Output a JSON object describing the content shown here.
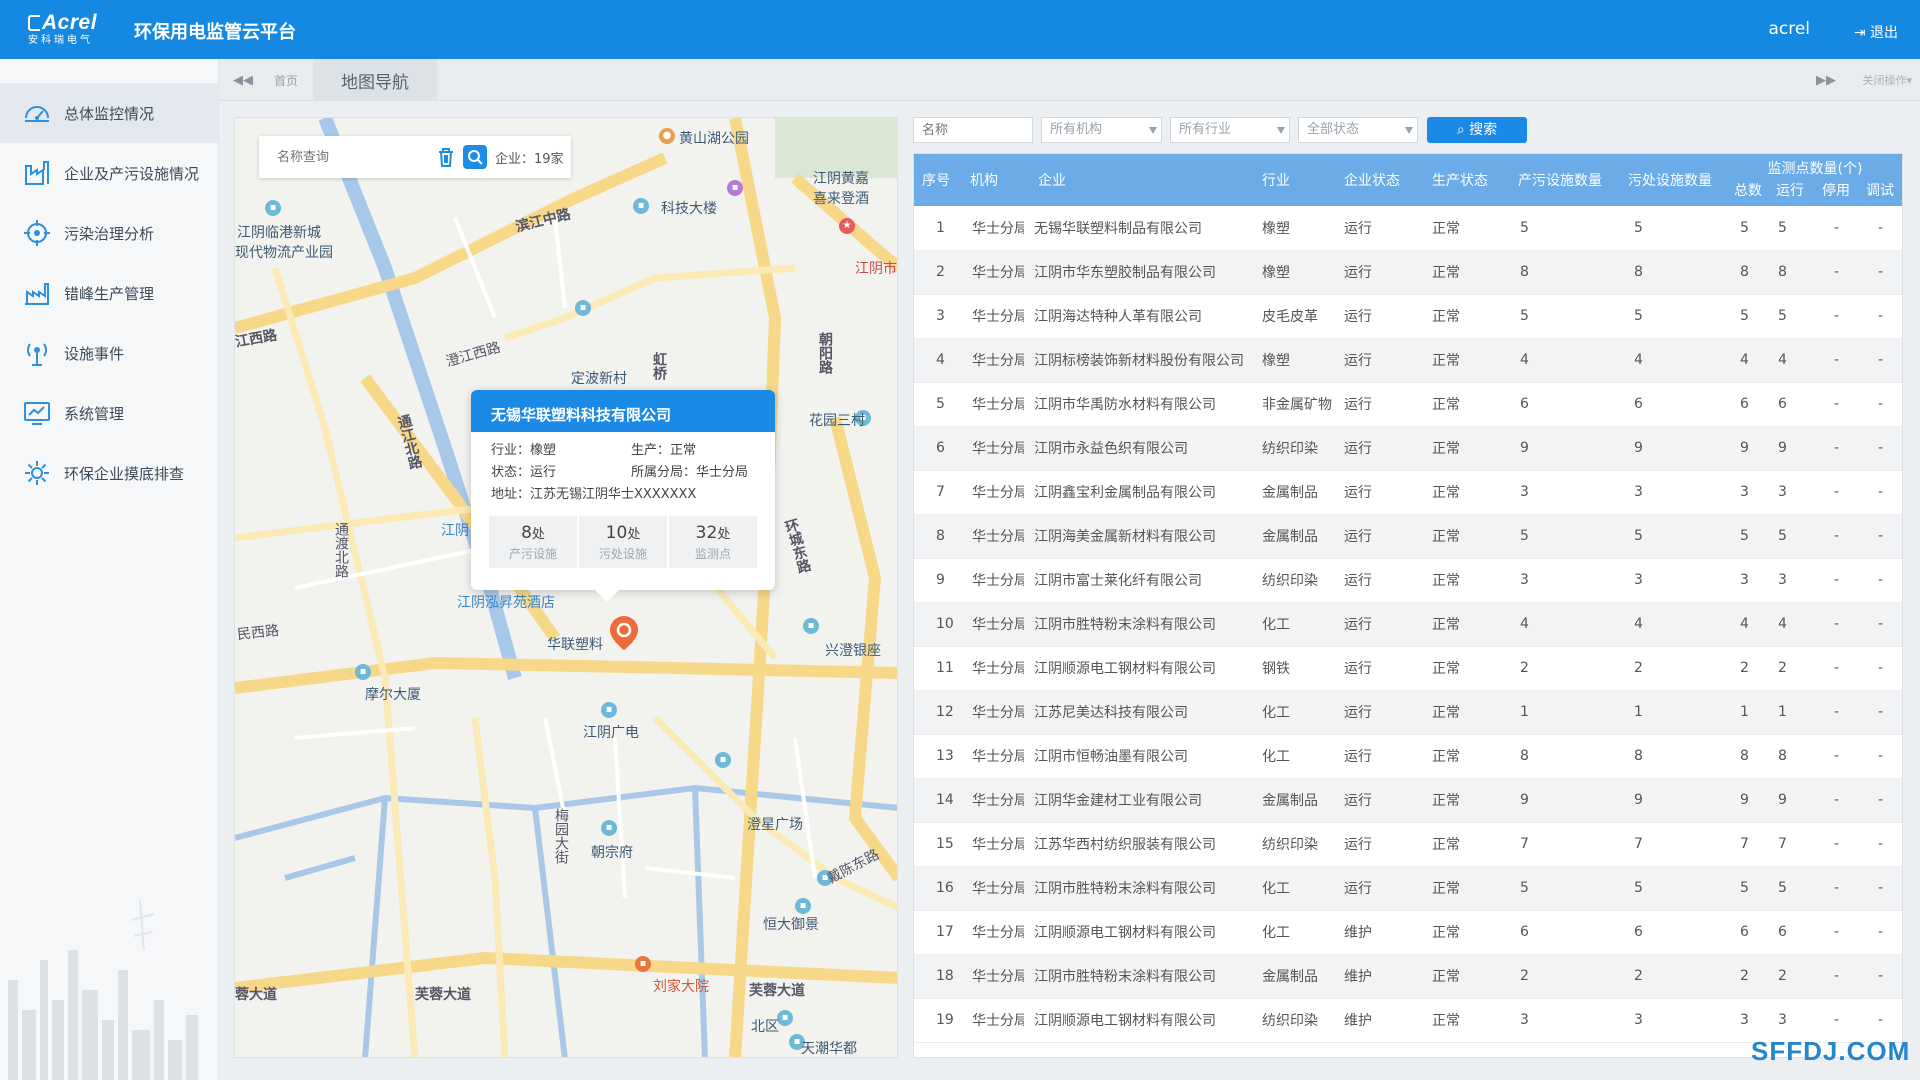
{
  "header": {
    "brand": "Acrel",
    "brand_sub": "安科瑞电气",
    "platform_title": "环保用电监管云平台",
    "username": "acrel",
    "logout_label": "退出",
    "color": "#1588e2"
  },
  "sidebar": {
    "items": [
      {
        "label": "总体监控情况",
        "icon": "dashboard-icon",
        "active": true
      },
      {
        "label": "企业及产污设施情况",
        "icon": "factory-icon"
      },
      {
        "label": "污染治理分析",
        "icon": "target-icon"
      },
      {
        "label": "错峰生产管理",
        "icon": "factory-line-icon"
      },
      {
        "label": "设施事件",
        "icon": "broadcast-icon"
      },
      {
        "label": "系统管理",
        "icon": "monitor-chart-icon"
      },
      {
        "label": "环保企业摸底排查",
        "icon": "gear-icon"
      }
    ]
  },
  "tabs": {
    "home": "首页",
    "map_nav": "地图导航",
    "close_ops": "关闭操作"
  },
  "map": {
    "search_placeholder": "名称查询",
    "company_count": "企业：19家",
    "labels": [
      "黄山湖公园",
      "科技大楼",
      "滨江中路",
      "江阴临港新城",
      "现代物流产业园",
      "江阴黄嘉",
      "喜来登酒",
      "江阴市",
      "江西路",
      "澄江西路",
      "定波新村",
      "虹桥",
      "朝阳路",
      "花园三村",
      "通江北路",
      "通渡北路",
      "江阴",
      "环城东路",
      "江阴泓昇苑酒店",
      "华联塑料",
      "兴澄银座",
      "民西路",
      "摩尔大厦",
      "江阴广电",
      "澄星广场",
      "梅园大街",
      "朝宗府",
      "戴陈东路",
      "恒大御景",
      "芙蓉大道",
      "刘家大院",
      "北区",
      "天潮华都",
      "蓉大道"
    ],
    "popup": {
      "title": "无锡华联塑料科技有限公司",
      "industry": "行业：橡塑",
      "production": "生产：正常",
      "status": "状态：运行",
      "branch": "所属分局：华士分局",
      "address": "地址：江苏无锡江阴华士XXXXXXX",
      "stats": [
        {
          "value": "8",
          "unit": "处",
          "label": "产污设施"
        },
        {
          "value": "10",
          "unit": "处",
          "label": "污处设施"
        },
        {
          "value": "32",
          "unit": "处",
          "label": "监测点"
        }
      ]
    }
  },
  "filters": {
    "name_placeholder": "名称",
    "org": "所有机构",
    "industry": "所有行业",
    "status": "全部状态",
    "search_label": "搜索"
  },
  "table": {
    "headers": [
      "序号",
      "机构",
      "企业",
      "行业",
      "企业状态",
      "生产状态",
      "产污设施数量",
      "污处设施数量"
    ],
    "monitor_header": "监测点数量(个)",
    "monitor_sub": [
      "总数",
      "运行",
      "停用",
      "调试"
    ],
    "rows": [
      [
        "1",
        "华士分局",
        "无锡华联塑料制品有限公司",
        "橡塑",
        "运行",
        "正常",
        "5",
        "5",
        "5",
        "5",
        "-",
        "-"
      ],
      [
        "2",
        "华士分局",
        "江阴市华东塑胶制品有限公司",
        "橡塑",
        "运行",
        "正常",
        "8",
        "8",
        "8",
        "8",
        "-",
        "-"
      ],
      [
        "3",
        "华士分局",
        "江阴海达特种人革有限公司",
        "皮毛皮革",
        "运行",
        "正常",
        "5",
        "5",
        "5",
        "5",
        "-",
        "-"
      ],
      [
        "4",
        "华士分局",
        "江阴标榜装饰新材料股份有限公司",
        "橡塑",
        "运行",
        "正常",
        "4",
        "4",
        "4",
        "4",
        "-",
        "-"
      ],
      [
        "5",
        "华士分局",
        "江阴市华禹防水材料有限公司",
        "非金属矿物",
        "运行",
        "正常",
        "6",
        "6",
        "6",
        "6",
        "-",
        "-"
      ],
      [
        "6",
        "华士分局",
        "江阴市永益色织有限公司",
        "纺织印染",
        "运行",
        "正常",
        "9",
        "9",
        "9",
        "9",
        "-",
        "-"
      ],
      [
        "7",
        "华士分局",
        "江阴鑫宝利金属制品有限公司",
        "金属制品",
        "运行",
        "正常",
        "3",
        "3",
        "3",
        "3",
        "-",
        "-"
      ],
      [
        "8",
        "华士分局",
        "江阴海美金属新材料有限公司",
        "金属制品",
        "运行",
        "正常",
        "5",
        "5",
        "5",
        "5",
        "-",
        "-"
      ],
      [
        "9",
        "华士分局",
        "江阴市富士莱化纤有限公司",
        "纺织印染",
        "运行",
        "正常",
        "3",
        "3",
        "3",
        "3",
        "-",
        "-"
      ],
      [
        "10",
        "华士分局",
        "江阴市胜特粉末涂料有限公司",
        "化工",
        "运行",
        "正常",
        "4",
        "4",
        "4",
        "4",
        "-",
        "-"
      ],
      [
        "11",
        "华士分局",
        "江阴顺源电工钢材料有限公司",
        "钢铁",
        "运行",
        "正常",
        "2",
        "2",
        "2",
        "2",
        "-",
        "-"
      ],
      [
        "12",
        "华士分局",
        "江苏尼美达科技有限公司",
        "化工",
        "运行",
        "正常",
        "1",
        "1",
        "1",
        "1",
        "-",
        "-"
      ],
      [
        "13",
        "华士分局",
        "江阴市恒畅油墨有限公司",
        "化工",
        "运行",
        "正常",
        "8",
        "8",
        "8",
        "8",
        "-",
        "-"
      ],
      [
        "14",
        "华士分局",
        "江阴华金建材工业有限公司",
        "金属制品",
        "运行",
        "正常",
        "9",
        "9",
        "9",
        "9",
        "-",
        "-"
      ],
      [
        "15",
        "华士分局",
        "江苏华西村纺织服装有限公司",
        "纺织印染",
        "运行",
        "正常",
        "7",
        "7",
        "7",
        "7",
        "-",
        "-"
      ],
      [
        "16",
        "华士分局",
        "江阴市胜特粉末涂料有限公司",
        "化工",
        "运行",
        "正常",
        "5",
        "5",
        "5",
        "5",
        "-",
        "-"
      ],
      [
        "17",
        "华士分局",
        "江阴顺源电工钢材料有限公司",
        "化工",
        "维护",
        "正常",
        "6",
        "6",
        "6",
        "6",
        "-",
        "-"
      ],
      [
        "18",
        "华士分局",
        "江阴市胜特粉末涂料有限公司",
        "金属制品",
        "维护",
        "正常",
        "2",
        "2",
        "2",
        "2",
        "-",
        "-"
      ],
      [
        "19",
        "华士分局",
        "江阴顺源电工钢材料有限公司",
        "纺织印染",
        "维护",
        "正常",
        "3",
        "3",
        "3",
        "3",
        "-",
        "-"
      ]
    ]
  },
  "watermark": "SFFDJ.COM"
}
